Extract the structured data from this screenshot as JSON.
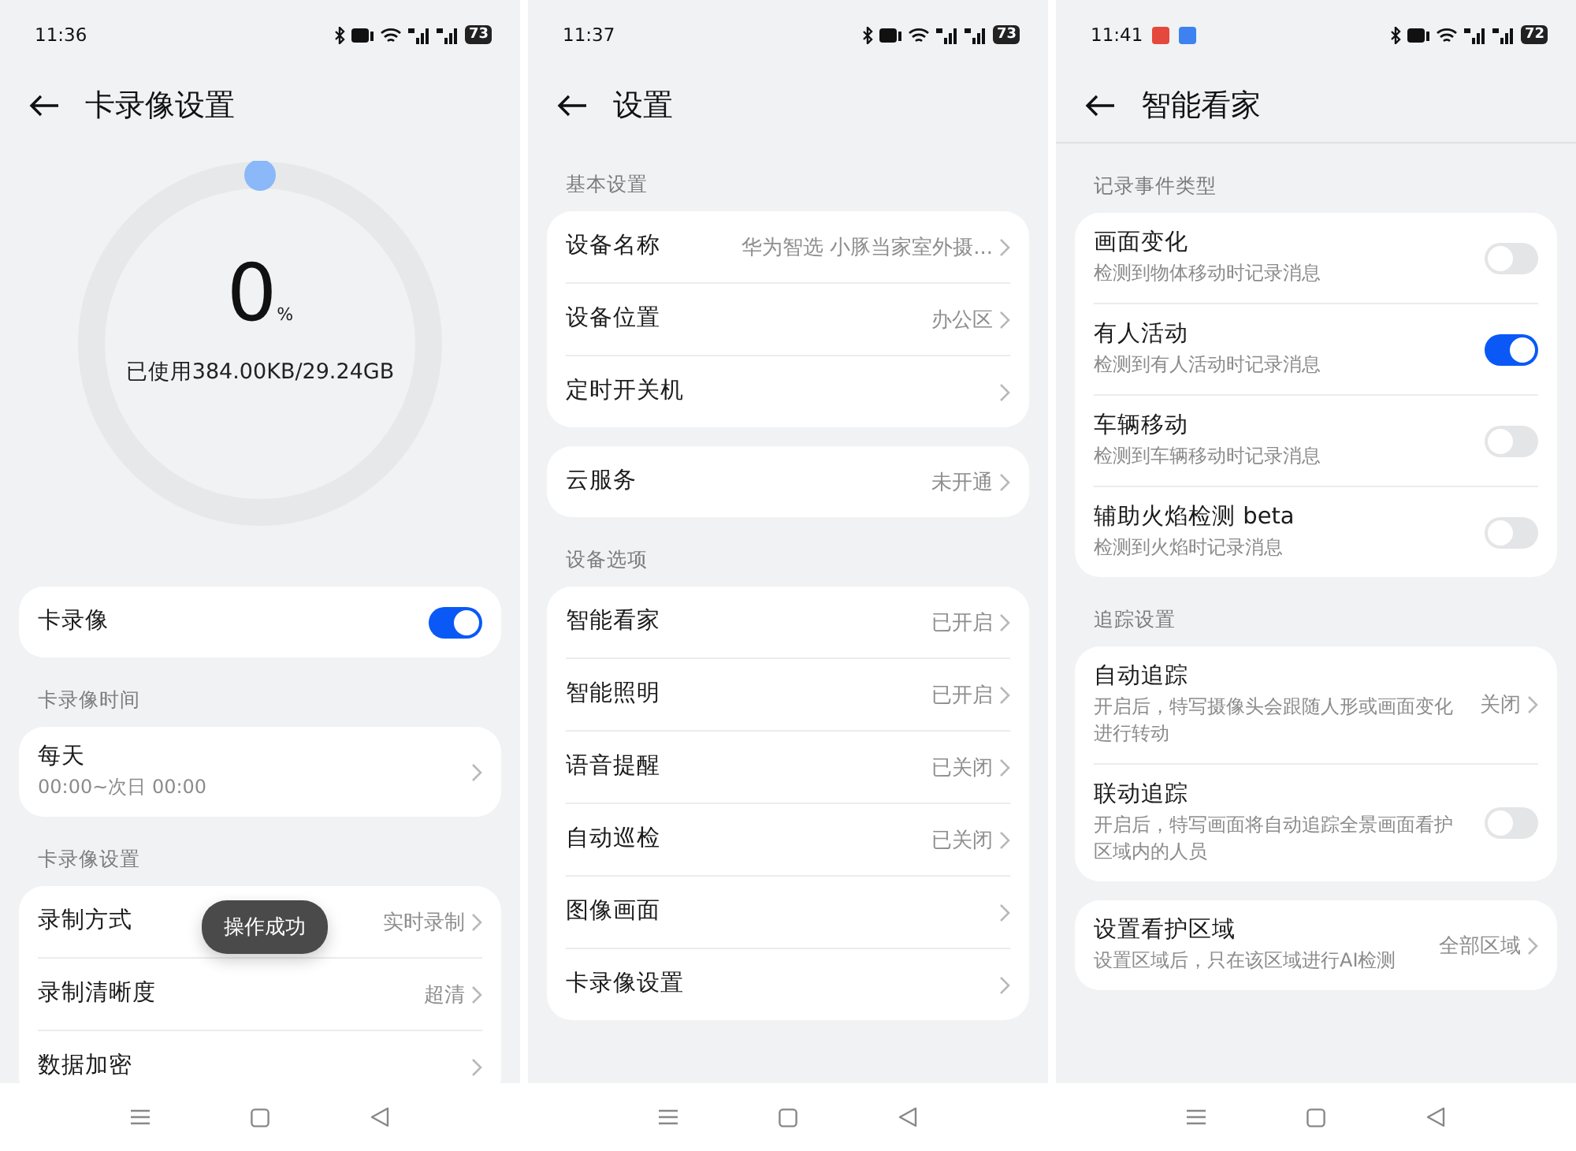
{
  "screens": [
    {
      "status": {
        "time": "11:36",
        "battery": "73"
      },
      "title": "卡录像设置",
      "storage": {
        "percent": "0",
        "unit": "%",
        "usage": "已使用384.00KB/29.24GB",
        "level": 0
      },
      "sections": [
        {
          "items": [
            {
              "kind": "toggle",
              "label": "卡录像",
              "on": true
            }
          ]
        },
        {
          "header": "卡录像时间",
          "items": [
            {
              "kind": "link",
              "label": "每天",
              "subtitle": "00:00~次日 00:00"
            }
          ]
        },
        {
          "header": "卡录像设置",
          "items": [
            {
              "kind": "link",
              "label": "录制方式",
              "value": "实时录制"
            },
            {
              "kind": "link",
              "label": "录制清晰度",
              "value": "超清"
            },
            {
              "kind": "link",
              "label": "数据加密"
            }
          ]
        }
      ],
      "toast": "操作成功"
    },
    {
      "status": {
        "time": "11:37",
        "battery": "73"
      },
      "title": "设置",
      "sections": [
        {
          "header": "基本设置",
          "items": [
            {
              "kind": "link",
              "label": "设备名称",
              "value": "华为智选 小豚当家室外摄..."
            },
            {
              "kind": "link",
              "label": "设备位置",
              "value": "办公区"
            },
            {
              "kind": "link",
              "label": "定时开关机"
            }
          ]
        },
        {
          "items": [
            {
              "kind": "link",
              "label": "云服务",
              "value": "未开通"
            }
          ]
        },
        {
          "header": "设备选项",
          "items": [
            {
              "kind": "link",
              "label": "智能看家",
              "value": "已开启"
            },
            {
              "kind": "link",
              "label": "智能照明",
              "value": "已开启"
            },
            {
              "kind": "link",
              "label": "语音提醒",
              "value": "已关闭"
            },
            {
              "kind": "link",
              "label": "自动巡检",
              "value": "已关闭"
            },
            {
              "kind": "link",
              "label": "图像画面"
            },
            {
              "kind": "link",
              "label": "卡录像设置"
            }
          ]
        }
      ]
    },
    {
      "status": {
        "time": "11:41",
        "battery": "72",
        "notifications": [
          {
            "color": "#e5483c"
          },
          {
            "color": "#3d82f0"
          }
        ]
      },
      "title": "智能看家",
      "sections": [
        {
          "header": "记录事件类型",
          "items": [
            {
              "kind": "toggle",
              "label": "画面变化",
              "subtitle": "检测到物体移动时记录消息",
              "on": false
            },
            {
              "kind": "toggle",
              "label": "有人活动",
              "subtitle": "检测到有人活动时记录消息",
              "on": true
            },
            {
              "kind": "toggle",
              "label": "车辆移动",
              "subtitle": "检测到车辆移动时记录消息",
              "on": false
            },
            {
              "kind": "toggle",
              "label": "辅助火焰检测 beta",
              "subtitle": "检测到火焰时记录消息",
              "on": false
            }
          ]
        },
        {
          "header": "追踪设置",
          "items": [
            {
              "kind": "link",
              "label": "自动追踪",
              "subtitle": "开启后，特写摄像头会跟随人形或画面变化进行转动",
              "value": "关闭"
            },
            {
              "kind": "toggle",
              "label": "联动追踪",
              "subtitle": "开启后，特写画面将自动追踪全景画面看护区域内的人员",
              "on": false
            }
          ]
        },
        {
          "items": [
            {
              "kind": "link",
              "label": "设置看护区域",
              "subtitle": "设置区域后，只在该区域进行AI检测",
              "value": "全部区域"
            }
          ]
        }
      ]
    }
  ]
}
